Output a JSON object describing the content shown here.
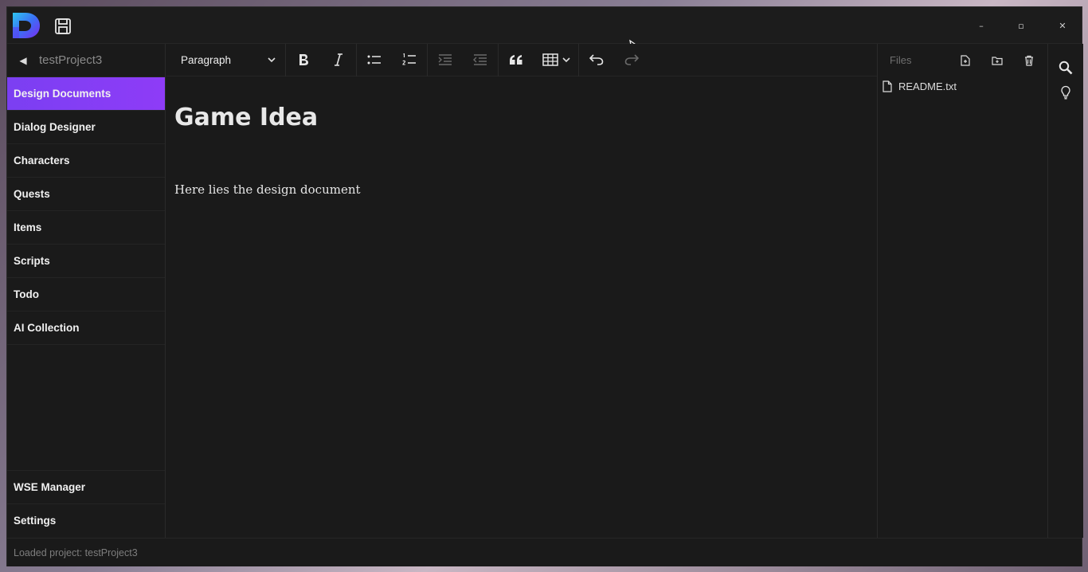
{
  "app": {
    "accent": "#8a3cf6"
  },
  "sidebar": {
    "project_name": "testProject3",
    "items": [
      {
        "label": "Design Documents",
        "active": true
      },
      {
        "label": "Dialog Designer"
      },
      {
        "label": "Characters"
      },
      {
        "label": "Quests"
      },
      {
        "label": "Items"
      },
      {
        "label": "Scripts"
      },
      {
        "label": "Todo"
      },
      {
        "label": "AI Collection"
      }
    ],
    "bottom_items": [
      {
        "label": "WSE Manager"
      },
      {
        "label": "Settings"
      }
    ]
  },
  "toolbar": {
    "block_format": "Paragraph",
    "buttons": [
      "bold-icon",
      "italic-icon",
      "bulleted-list-icon",
      "numbered-list-icon",
      "outdent-icon",
      "indent-icon",
      "blockquote-icon",
      "table-icon",
      "undo-icon",
      "redo-icon"
    ]
  },
  "editor": {
    "title": "Game Idea",
    "body": "Here lies the design document"
  },
  "files": {
    "placeholder": "Files",
    "items": [
      {
        "name": "README.txt"
      }
    ]
  },
  "status": {
    "text": "Loaded project: testProject3"
  }
}
